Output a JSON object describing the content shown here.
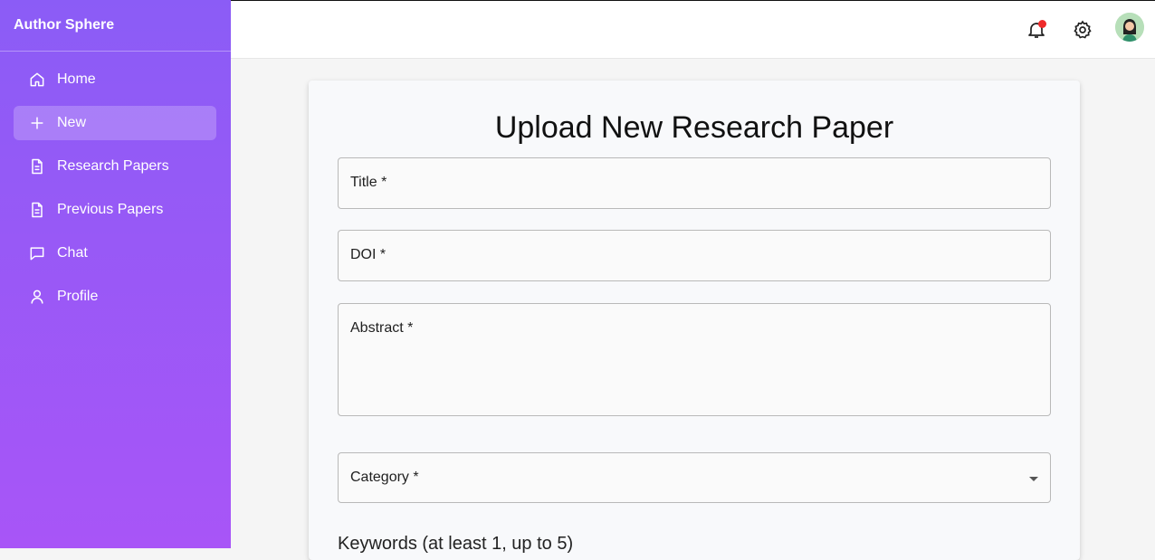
{
  "app": {
    "title": "Author Sphere"
  },
  "sidebar": {
    "items": [
      {
        "label": "Home",
        "icon": "home-icon"
      },
      {
        "label": "New",
        "icon": "plus-icon",
        "active": true
      },
      {
        "label": "Research Papers",
        "icon": "document-icon"
      },
      {
        "label": "Previous Papers",
        "icon": "document-icon"
      },
      {
        "label": "Chat",
        "icon": "chat-icon"
      },
      {
        "label": "Profile",
        "icon": "user-icon"
      }
    ]
  },
  "header": {
    "notifications_icon": "bell-icon",
    "settings_icon": "gear-icon",
    "avatar": "user-avatar"
  },
  "form": {
    "title": "Upload New Research Paper",
    "fields": {
      "title": "Title *",
      "doi": "DOI *",
      "abstract": "Abstract *",
      "category": "Category *"
    },
    "keywords_label": "Keywords (at least 1, up to 5)"
  },
  "colors": {
    "sidebar_top": "#8b5cf6",
    "sidebar_bottom": "#a855f7",
    "notification_dot": "#ef2b2b"
  }
}
